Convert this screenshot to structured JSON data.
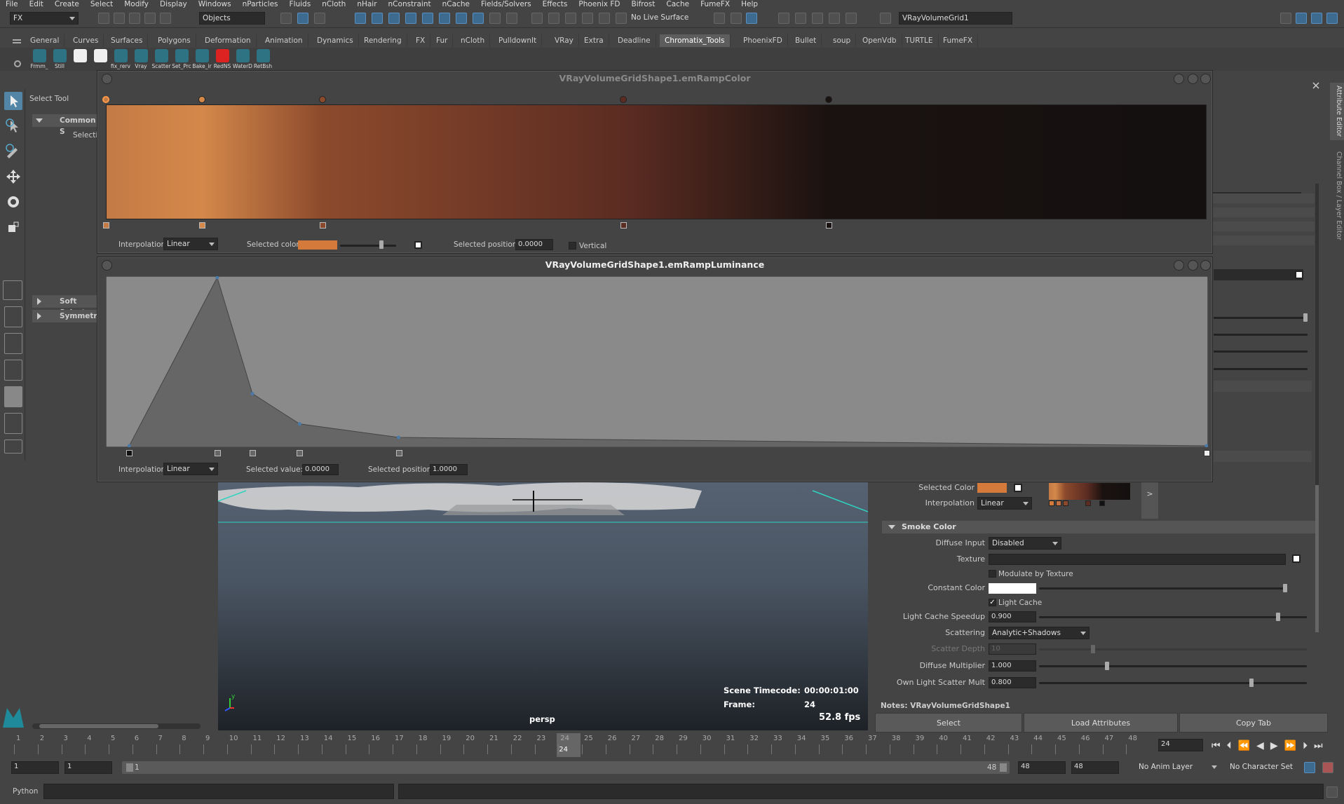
{
  "menubar": [
    "File",
    "Edit",
    "Create",
    "Select",
    "Modify",
    "Display",
    "Windows",
    "nParticles",
    "Fluids",
    "nCloth",
    "nHair",
    "nConstraint",
    "nCache",
    "Fields/Solvers",
    "Effects",
    "Phoenix FD",
    "Bifrost",
    "Cache",
    "FumeFX",
    "Help"
  ],
  "status": {
    "menuset": "FX",
    "selection_mode": "Objects",
    "live_surface": "No Live Surface",
    "name_field": "VRayVolumeGrid1"
  },
  "shelf_tabs": [
    "General",
    "Curves",
    "Surfaces",
    "Polygons",
    "Deformation",
    "Animation",
    "Dynamics",
    "Rendering",
    "FX",
    "Fur",
    "nCloth",
    "PulldownIt",
    "VRay",
    "Extra",
    "Deadline",
    "Chromatix_Tools",
    "PhoenixFD",
    "Bullet",
    "soup",
    "OpenVdb",
    "TURTLE",
    "FumeFX"
  ],
  "shelf_active": "Chromatix_Tools",
  "shelf_buttons": [
    "Frmm_",
    "Still",
    "",
    "",
    "fix_rerv",
    "Vray",
    "Scatter",
    "Set_Prc",
    "Bake_ir",
    "RedNS",
    "WaterD",
    "RetBsh"
  ],
  "tool_panel": {
    "title": "Select Tool",
    "common": "Common S",
    "selection": "Selecti",
    "soft": "Soft Select",
    "symmetry": "Symmetry"
  },
  "color_ramp": {
    "title": "VRayVolumeGridShape1.emRampColor",
    "interpolation_label": "Interpolation:",
    "interpolation": "Linear",
    "selected_color_label": "Selected color:",
    "selected_position_label": "Selected position:",
    "selected_position": "0.0000",
    "vertical_label": "Vertical",
    "stops": [
      {
        "pos": 0.0,
        "color": "#c47a45"
      },
      {
        "pos": 0.087,
        "color": "#d4884a"
      },
      {
        "pos": 0.197,
        "color": "#8c4a2c"
      },
      {
        "pos": 0.47,
        "color": "#5c2c22"
      },
      {
        "pos": 0.657,
        "color": "#1a1210"
      },
      {
        "pos": 1.0,
        "color": "#141010"
      }
    ]
  },
  "lum_ramp": {
    "title": "VRayVolumeGridShape1.emRampLuminance",
    "interpolation_label": "Interpolation:",
    "interpolation": "Linear",
    "selected_value_label": "Selected value:",
    "selected_value": "0.0000",
    "selected_position_label": "Selected position:",
    "selected_position": "1.0000",
    "points": [
      [
        0.02,
        0.0
      ],
      [
        0.1,
        1.0
      ],
      [
        0.132,
        0.31
      ],
      [
        0.175,
        0.13
      ],
      [
        0.265,
        0.05
      ],
      [
        1.0,
        0.0
      ]
    ]
  },
  "viewport": {
    "timecode_label": "Scene Timecode:",
    "timecode": "00:00:01:00",
    "frame_label": "Frame:",
    "frame": "24",
    "camera": "persp",
    "fps": "52.8 fps"
  },
  "attr": {
    "selected_color_label": "Selected Color",
    "interpolation_label": "Interpolation",
    "interpolation": "Linear",
    "expand_btn": ">",
    "section_smoke": "Smoke Color",
    "diffuse_input_label": "Diffuse Input",
    "diffuse_input": "Disabled",
    "texture_label": "Texture",
    "modulate_label": "Modulate by Texture",
    "constant_color_label": "Constant Color",
    "light_cache_label": "Light Cache",
    "lc_speedup_label": "Light Cache Speedup",
    "lc_speedup": "0.900",
    "scattering_label": "Scattering",
    "scattering": "Analytic+Shadows",
    "scatter_depth_label": "Scatter Depth",
    "scatter_depth": "10",
    "diffuse_mult_label": "Diffuse Multiplier",
    "diffuse_mult": "1.000",
    "own_light_label": "Own Light Scatter Mult",
    "own_light": "0.800",
    "notes": "Notes:  VRayVolumeGridShape1",
    "btn_select": "Select",
    "btn_load": "Load Attributes",
    "btn_copy": "Copy Tab",
    "side_tab1": "Attribute Editor",
    "side_tab2": "Channel Box / Layer Editor"
  },
  "timeline": {
    "ticks": [
      "1",
      "2",
      "3",
      "4",
      "5",
      "6",
      "7",
      "8",
      "9",
      "10",
      "11",
      "12",
      "13",
      "14",
      "15",
      "16",
      "17",
      "18",
      "19",
      "20",
      "21",
      "22",
      "23",
      "24",
      "25",
      "26",
      "27",
      "28",
      "29",
      "30",
      "31",
      "32",
      "33",
      "34",
      "35",
      "36",
      "37",
      "38",
      "39",
      "40",
      "41",
      "42",
      "43",
      "44",
      "45",
      "46",
      "47",
      "48"
    ],
    "current": "24",
    "current_field": "24"
  },
  "range": {
    "start": "1",
    "start2": "1",
    "slider_start": "1",
    "slider_end": "48",
    "end": "48",
    "end2": "48",
    "anim_layer": "No Anim Layer",
    "char_set": "No Character Set"
  },
  "cmdline": {
    "label": "Python"
  }
}
